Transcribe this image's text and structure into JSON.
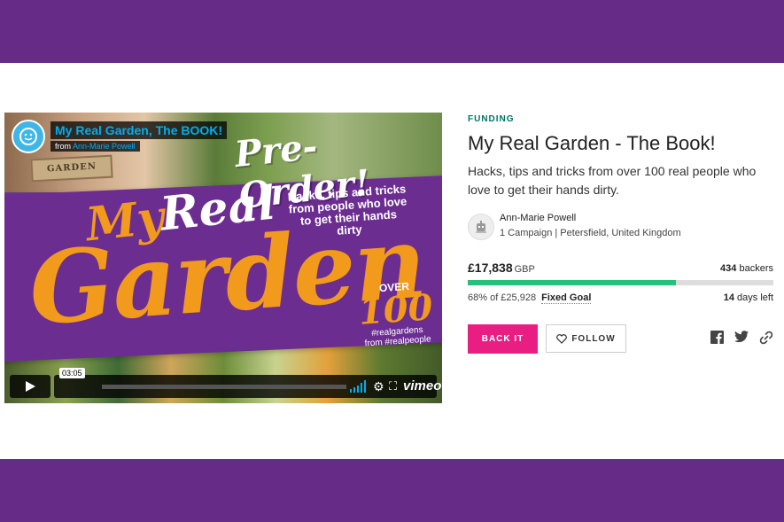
{
  "video": {
    "title": "My Real Garden, The BOOK!",
    "from_label": "from",
    "author": "Ann-Marie Powell",
    "duration": "03:05",
    "brand": "vimeo",
    "cover": {
      "sign": "GARDEN",
      "preorder": "Pre-Order!",
      "hacks": "Hacks, tips and tricks from people who love to get their hands dirty",
      "my": "My",
      "real": "Real",
      "garden": "Garden",
      "over": "OVER",
      "count": "100",
      "tag1": "#realgardens",
      "tag2": "from #realpeople"
    }
  },
  "project": {
    "category": "FUNDING",
    "title": "My Real Garden - The Book!",
    "blurb": "Hacks, tips and tricks from over 100 real people who love to get their hands dirty.",
    "creator_name": "Ann-Marie Powell",
    "creator_meta": "1 Campaign | Petersfield, United Kingdom",
    "pledged": "£17,838",
    "currency": "GBP",
    "backers_count": "434",
    "backers_label": "backers",
    "percent_text": "68% of £25,928",
    "goal_type": "Fixed Goal",
    "progress_fraction": 0.68,
    "days_count": "14",
    "days_label": "days left"
  },
  "actions": {
    "back_label": "BACK IT",
    "follow_label": "FOLLOW",
    "share_icons": [
      "facebook-icon",
      "twitter-icon",
      "link-icon"
    ]
  },
  "colors": {
    "band": "#662a87",
    "accent_pink": "#e91e83",
    "progress_green": "#25c17a",
    "category_green": "#037362"
  }
}
